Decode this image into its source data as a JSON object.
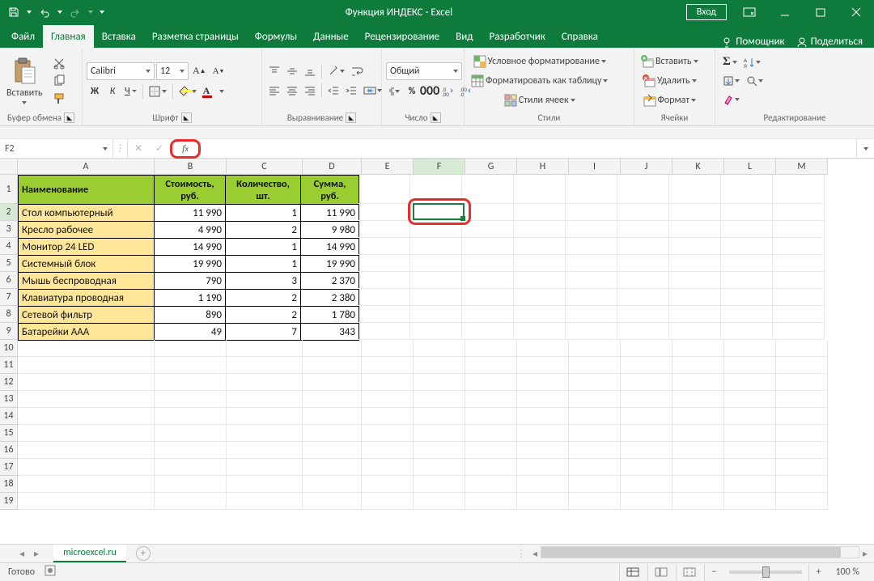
{
  "title": "Функция ИНДЕКС  -  Excel",
  "titlebar": {
    "login": "Вход"
  },
  "tabs": {
    "items": [
      "Файл",
      "Главная",
      "Вставка",
      "Разметка страницы",
      "Формулы",
      "Данные",
      "Рецензирование",
      "Вид",
      "Разработчик",
      "Справка"
    ],
    "active": 1,
    "help": "Помощник",
    "share": "Поделиться"
  },
  "ribbon": {
    "clipboard": {
      "paste": "Вставить",
      "label": "Буфер обмена"
    },
    "font": {
      "label": "Шрифт",
      "name": "Calibri",
      "size": "12",
      "b": "Ж",
      "i": "К",
      "u": "Ч"
    },
    "alignment": {
      "label": "Выравнивание"
    },
    "number": {
      "label": "Число",
      "type": "Общий"
    },
    "styles": {
      "label": "Стили",
      "cond": "Условное форматирование",
      "table": "Форматировать как таблицу",
      "cell": "Стили ячеек"
    },
    "cells": {
      "label": "Ячейки",
      "insert": "Вставить",
      "delete": "Удалить",
      "format": "Формат"
    },
    "editing": {
      "label": "Редактирование"
    }
  },
  "fx": {
    "cellref": "F2",
    "formula": ""
  },
  "grid": {
    "cols": [
      "A",
      "B",
      "C",
      "D",
      "E",
      "F",
      "G",
      "H",
      "I",
      "J",
      "K",
      "L",
      "M"
    ],
    "headers": [
      "Наименование",
      "Стоимость, руб.",
      "Количество, шт.",
      "Сумма, руб."
    ],
    "rows": [
      {
        "name": "Стол компьютерный",
        "cost": "11 990",
        "qty": "1",
        "sum": "11 990"
      },
      {
        "name": "Кресло рабочее",
        "cost": "4 990",
        "qty": "2",
        "sum": "9 980"
      },
      {
        "name": "Монитор 24 LED",
        "cost": "14 990",
        "qty": "1",
        "sum": "14 990"
      },
      {
        "name": "Системный блок",
        "cost": "19 990",
        "qty": "1",
        "sum": "19 990"
      },
      {
        "name": "Мышь беспроводная",
        "cost": "790",
        "qty": "3",
        "sum": "2 370"
      },
      {
        "name": "Клавиатура проводная",
        "cost": "1 190",
        "qty": "2",
        "sum": "2 380"
      },
      {
        "name": "Сетевой фильтр",
        "cost": "890",
        "qty": "2",
        "sum": "1 780"
      },
      {
        "name": "Батарейки AAA",
        "cost": "49",
        "qty": "7",
        "sum": "343"
      }
    ],
    "rowcount": 19
  },
  "sheets": {
    "active": "microexcel.ru"
  },
  "status": {
    "ready": "Готово",
    "zoom": "100 %"
  }
}
